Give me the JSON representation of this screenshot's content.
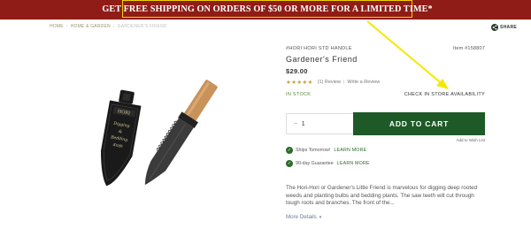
{
  "banner": {
    "text": "GET FREE SHIPPING ON ORDERS OF $50 OR MORE FOR A LIMITED TIME*"
  },
  "breadcrumb": {
    "items": [
      "HOME",
      "HOME & GARDEN",
      "GARDENER'S FRIEND"
    ],
    "separator": "›"
  },
  "share": {
    "label": "SHARE"
  },
  "product": {
    "sku": "#HORI HORI STD HANDLE",
    "item_number": "Item #158807",
    "title": "Gardener's Friend",
    "price": "$29.00",
    "stars": "★★★★★",
    "reviews": "(1) Review",
    "rating_separator": "|",
    "write_review": "Write a Review",
    "stock_status": "IN STOCK",
    "check_store": "CHECK IN STORE AVAILABILITY",
    "description": "The Hori-Hori or Gardener's Little Friend is marvelous for digging deep rooted weeds and planting bulbs and bedding plants. The saw teeth will cut through tough roots and branches. The front of the...",
    "more_details": "More Details",
    "more_caret": "▾"
  },
  "cart": {
    "quantity": "1",
    "quantity_stepper": "–",
    "add_to_cart": "ADD TO CART",
    "add_to_wishlist": "Add to Wish List"
  },
  "shipping": {
    "check_glyph": "✓",
    "ships_tomorrow": "Ships Tomorrow!",
    "ships_learn_more": "LEARN MORE",
    "guarantee": "90-day Guarantee",
    "guarantee_learn_more": "LEARN MORE"
  },
  "colors": {
    "banner_bg": "#8f1c16",
    "banner_border": "#f1d200",
    "cart_button": "#1d5a27",
    "in_stock": "#5c8a3a",
    "annotation_arrow": "#f5e800"
  },
  "icons": {
    "share": "share-icon",
    "check": "check-circle-icon",
    "caret": "chevron-down-icon"
  }
}
